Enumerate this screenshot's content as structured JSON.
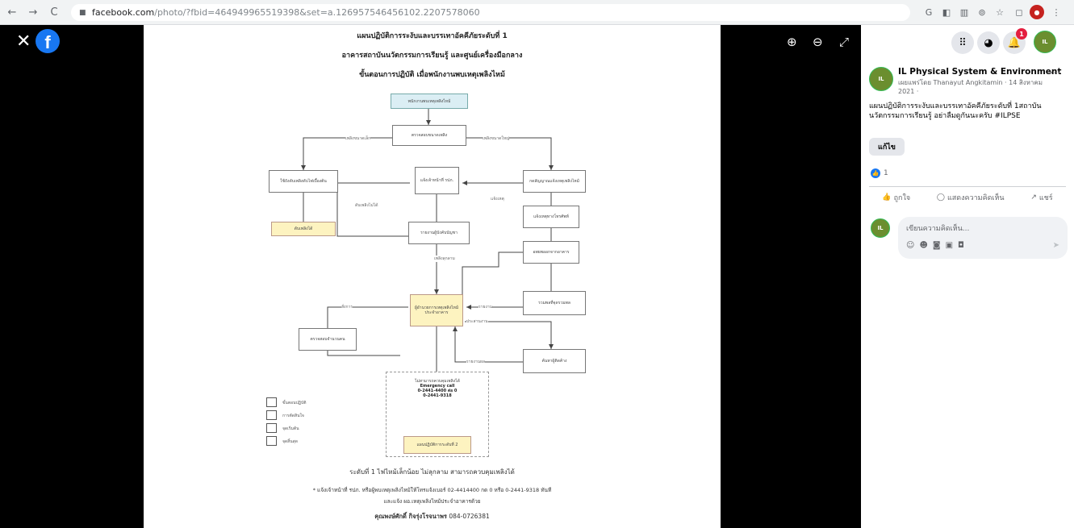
{
  "browser": {
    "back": "←",
    "forward": "→",
    "reload": "C",
    "url_host": "facebook.com",
    "url_path": "/photo/?fbid=464949965519398&set=a.126957546456102.2207578060"
  },
  "viewer": {
    "close": "✕",
    "zoom_in": "⊕",
    "zoom_out": "⊖",
    "fullscreen": "⤢",
    "document": {
      "title_1": "แผนปฏิบัติการระงับและบรรเทาอัคคีภัยระดับที่ 1",
      "title_2": "อาคารสถาบันนวัตกรรมการเรียนรู้ และศูนย์เครื่องมือกลาง",
      "title_3": "ขั้นตอนการปฏิบัติ เมื่อพนักงานพบเหตุเพลิงไหม้",
      "emergency_call": "Emergency call",
      "emergency_num1": "0-2441-4400 ต่อ 0",
      "emergency_num2": "0-2441-9318",
      "level_note": "ระดับที่ 1 ไฟไหม้เล็กน้อย ไม่ลุกลาม สามารถควบคุมเพลิงได้",
      "footer_note_1": "* แจ้งเจ้าหน้าที่ รปภ. หรือผู้พบเหตุเพลิงไหม้ให้โทรแจ้งเบอร์ 02-4414400 กด 0 หรือ 0-2441-9318 ทันที",
      "footer_note_2": "และแจ้ง ผอ.เหตุเพลิงไหม้ประจำอาคารด้วย",
      "footer_contact_name": "คุณพงษ์ศักดิ์ กิจรุ่งโรจนาพร",
      "footer_contact_phone": "084-0726381"
    }
  },
  "panel": {
    "badge_count": "1",
    "page_name": "IL Physical System & Environment",
    "byline": "เผยแพร่โดย Thanayut Angkitamin · 14 สิงหาคม 2021 ·",
    "post_text": "แผนปฏิบัติการระงับและบรรเทาอัคคีภัยระดับที่ 1สถาบันนวัตกรรมการเรียนรู้ อย่าลืมดูกันนะครับ #ILPSE",
    "edit_label": "แก้ไข",
    "reaction_count": "1",
    "like_label": "ถูกใจ",
    "comment_label": "แสดงความคิดเห็น",
    "share_label": "แชร์",
    "comment_placeholder": "เขียนความคิดเห็น..."
  }
}
